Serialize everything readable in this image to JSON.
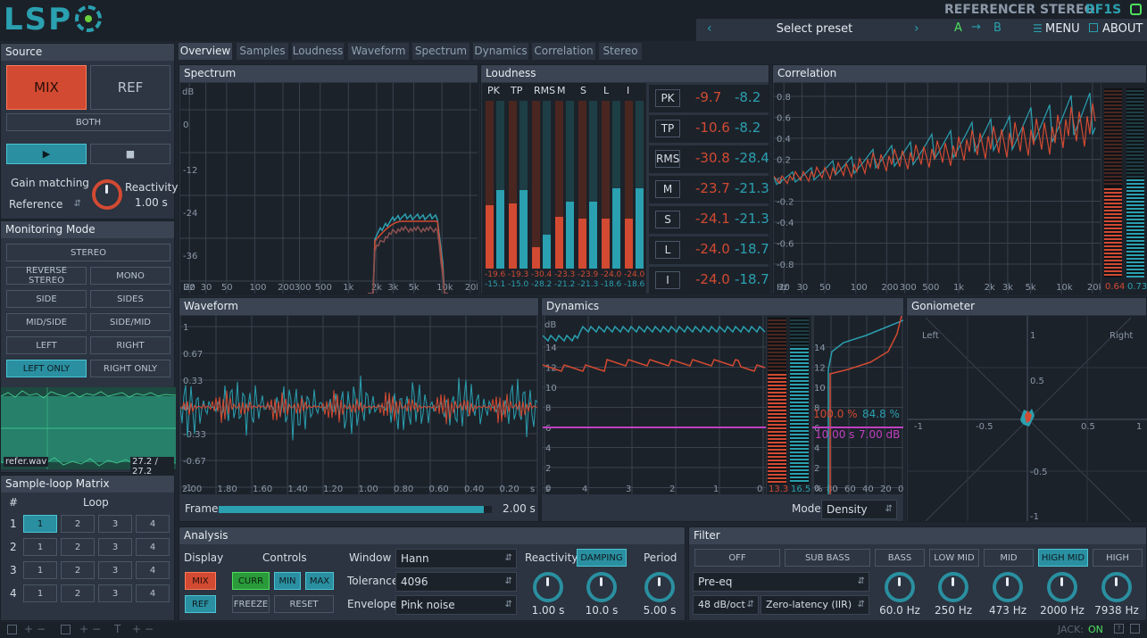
{
  "app": {
    "logo": "LSP",
    "plugin_name": "REFERENCER STEREO",
    "plugin_code": "RF1S",
    "preset": "Select preset",
    "ab_a": "A",
    "ab_b": "B",
    "menu": "MENU",
    "about": "ABOUT"
  },
  "tabs": [
    "Overview",
    "Samples",
    "Loudness",
    "Waveform",
    "Spectrum",
    "Dynamics",
    "Correlation",
    "Stereo"
  ],
  "source": {
    "title": "Source",
    "mix": "MIX",
    "ref": "REF",
    "both": "BOTH",
    "gain_label": "Gain matching",
    "gain_value": "Reference",
    "reactivity_label": "Reactivity",
    "reactivity_value": "1.00 s"
  },
  "monitoring": {
    "title": "Monitoring Mode",
    "stereo": "STEREO",
    "buttons": [
      "REVERSE STEREO",
      "MONO",
      "SIDE",
      "SIDES",
      "MID/SIDE",
      "SIDE/MID",
      "LEFT",
      "RIGHT",
      "LEFT ONLY",
      "RIGHT ONLY"
    ],
    "file": "refer.wav",
    "time": "27.2 / 27.2"
  },
  "matrix": {
    "title": "Sample-loop Matrix",
    "hash": "#",
    "loop": "Loop",
    "rows": [
      "1",
      "2",
      "3",
      "4"
    ],
    "cols": [
      "1",
      "2",
      "3",
      "4"
    ]
  },
  "spectrum": {
    "title": "Spectrum",
    "db": "dB",
    "y": [
      "0",
      "-12",
      "-24",
      "-36",
      "-48",
      "-60"
    ],
    "x": [
      "Hz",
      "20",
      "30",
      "50",
      "100",
      "200",
      "300",
      "500",
      "1k",
      "2k",
      "3k",
      "5k",
      "10k",
      "20k"
    ]
  },
  "loudness": {
    "title": "Loudness",
    "cols": [
      "PK",
      "TP",
      "RMS",
      "M",
      "S",
      "L",
      "I"
    ],
    "mix_vals": [
      "-19.6",
      "-19.3",
      "-30.4",
      "-23.3",
      "-23.9",
      "-24.0",
      "-24.0"
    ],
    "ref_vals": [
      "-15.1",
      "-15.0",
      "-28.2",
      "-21.2",
      "-21.3",
      "-18.6",
      "-18.6"
    ],
    "mix_levels": [
      0.38,
      0.39,
      0.13,
      0.31,
      0.3,
      0.3,
      0.3
    ],
    "ref_levels": [
      0.47,
      0.47,
      0.2,
      0.4,
      0.4,
      0.48,
      0.48
    ],
    "rows": [
      {
        "l": "PK",
        "a": "-9.7",
        "b": "-8.2"
      },
      {
        "l": "TP",
        "a": "-10.6",
        "b": "-8.2"
      },
      {
        "l": "RMS",
        "a": "-30.8",
        "b": "-28.4"
      },
      {
        "l": "M",
        "a": "-23.7",
        "b": "-21.3"
      },
      {
        "l": "S",
        "a": "-24.1",
        "b": "-21.3"
      },
      {
        "l": "L",
        "a": "-24.0",
        "b": "-18.7"
      },
      {
        "l": "I",
        "a": "-24.0",
        "b": "-18.7"
      }
    ]
  },
  "correlation": {
    "title": "Correlation",
    "y": [
      "0.8",
      "0.6",
      "0.4",
      "0.2",
      "0",
      "-0.2",
      "-0.4",
      "-0.6",
      "-0.8"
    ],
    "x": [
      "Hz",
      "20",
      "30",
      "50",
      "100",
      "200",
      "300",
      "500",
      "1k",
      "2k",
      "3k",
      "5k",
      "10k",
      "20k"
    ],
    "mix_val": "0.64",
    "ref_val": "0.73",
    "mix_level": 0.48,
    "ref_level": 0.53
  },
  "waveform": {
    "title": "Waveform",
    "y": [
      "1",
      "0.67",
      "0.33",
      "0",
      "-0.33",
      "-0.67",
      "-1"
    ],
    "x": [
      "2.00",
      "1.80",
      "1.60",
      "1.40",
      "1.20",
      "1.00",
      "0.80",
      "0.60",
      "0.40",
      "0.20",
      "s"
    ],
    "frame_label": "Frame",
    "frame_value": "2.00 s",
    "frame_fill": 0.97
  },
  "dynamics": {
    "title": "Dynamics",
    "db": "dB",
    "y": [
      "14",
      "12",
      "10",
      "8",
      "6",
      "4",
      "2",
      "0"
    ],
    "x": [
      "s",
      "4",
      "3",
      "2",
      "1",
      "0"
    ],
    "right_y": [
      "14",
      "12",
      "10",
      "8",
      "6",
      "4",
      "2",
      "0"
    ],
    "right_x": [
      "%",
      "80",
      "60",
      "40",
      "20",
      "0"
    ],
    "p_mix": "100.0 %",
    "p_ref": "84.8 %",
    "t_val": "10.00 s",
    "db_val": "7.00 dB",
    "meter_mix": "13.3",
    "meter_ref": "16.5",
    "mix_level": 0.67,
    "ref_level": 0.83,
    "mode_label": "Mode",
    "mode_value": "Density"
  },
  "goniometer": {
    "title": "Goniometer",
    "left": "Left",
    "right": "Right",
    "one": "1",
    "half": "0.5",
    "neg_half": "-0.5",
    "neg_one": "-1"
  },
  "analysis": {
    "title": "Analysis",
    "display": "Display",
    "mix": "MIX",
    "ref": "REF",
    "controls": "Controls",
    "curr": "CURR",
    "min": "MIN",
    "max": "MAX",
    "freeze": "FREEZE",
    "reset": "RESET",
    "window_label": "Window",
    "window_value": "Hann",
    "tolerance_label": "Tolerance",
    "tolerance_value": "4096",
    "envelope_label": "Envelope",
    "envelope_value": "Pink noise",
    "reactivity": "Reactivity",
    "damping": "DAMPING",
    "r1": "1.00 s",
    "r2": "10.0 s",
    "period": "Period",
    "period_value": "5.00 s"
  },
  "filter": {
    "title": "Filter",
    "buttons": [
      "OFF",
      "SUB BASS",
      "BASS",
      "LOW MID",
      "MID",
      "HIGH MID",
      "HIGH"
    ],
    "pos": "Pre-eq",
    "slope": "48 dB/oct",
    "mode": "Zero-latency (IIR)",
    "freqs": [
      "60.0 Hz",
      "250 Hz",
      "473 Hz",
      "2000 Hz",
      "7938 Hz"
    ]
  },
  "status": {
    "jack_label": "JACK:",
    "jack_value": "ON"
  },
  "colors": {
    "mix": "#d24a32",
    "ref": "#2aa0b0",
    "accent": "#2a8fa0",
    "bg": "#1f2630"
  }
}
